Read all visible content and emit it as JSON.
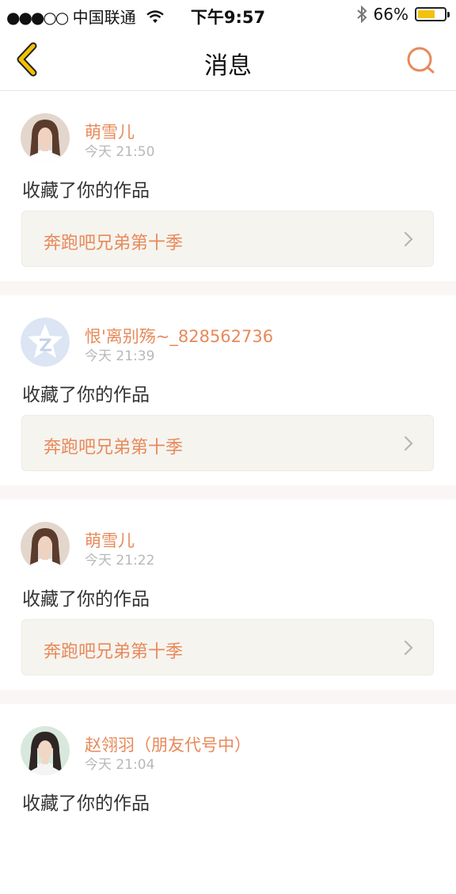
{
  "status_bar": {
    "signal": "●●●○○",
    "carrier": "中国联通",
    "time": "下午9:57",
    "battery": "66%",
    "battery_level": 0.66,
    "icons": [
      "wifi-icon",
      "bluetooth-icon",
      "battery-icon"
    ]
  },
  "nav": {
    "title": "消息",
    "back_icon": "chevron-left-icon",
    "search_icon": "search-icon"
  },
  "colors": {
    "accent": "#e8895a",
    "back_icon": "#f2c200",
    "card_bg": "#f5f4ef",
    "separator": "#fbf6f6"
  },
  "messages": [
    {
      "name": "萌雪儿",
      "time": "今天 21:50",
      "action": "收藏了你的作品",
      "work_title": "奔跑吧兄弟第十季",
      "avatar": "photo"
    },
    {
      "name": "恨'离别殇~_828562736",
      "time": "今天 21:39",
      "action": "收藏了你的作品",
      "work_title": "奔跑吧兄弟第十季",
      "avatar": "qq-default-avatar"
    },
    {
      "name": "萌雪儿",
      "time": "今天 21:22",
      "action": "收藏了你的作品",
      "work_title": "奔跑吧兄弟第十季",
      "avatar": "photo"
    },
    {
      "name": "赵翎羽（朋友代号中）",
      "time": "今天 21:04",
      "action": "收藏了你的作品",
      "work_title": "",
      "avatar": "photo"
    }
  ]
}
